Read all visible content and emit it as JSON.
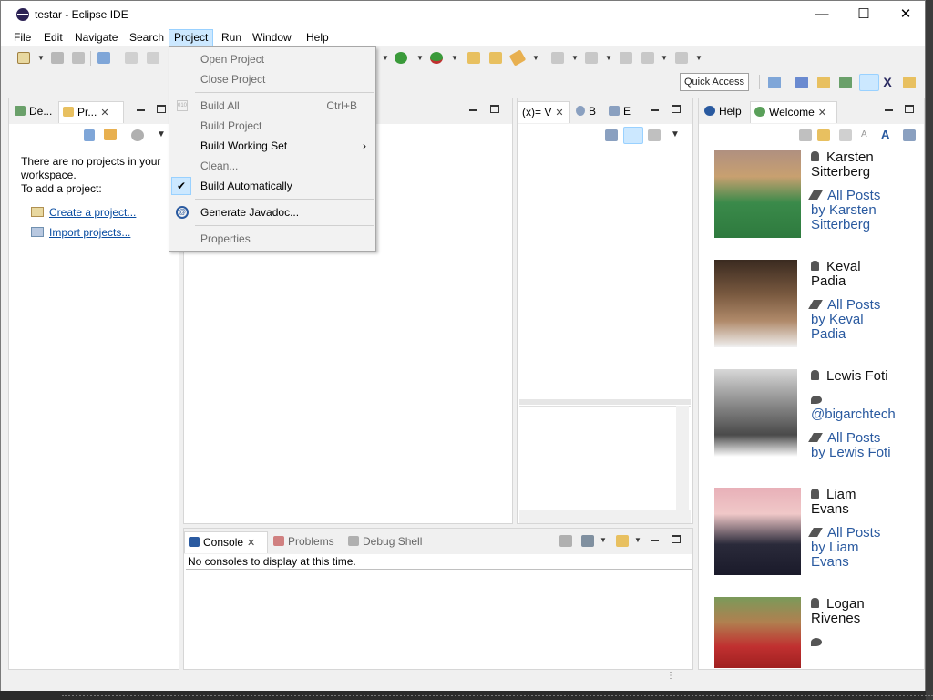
{
  "window": {
    "title": "testar - Eclipse IDE",
    "controls": {
      "minimize": "—",
      "maximize": "☐",
      "close": "✕"
    }
  },
  "menubar": [
    "File",
    "Edit",
    "Navigate",
    "Search",
    "Project",
    "Run",
    "Window",
    "Help"
  ],
  "active_menu": "Project",
  "project_menu": {
    "items": [
      {
        "label": "Open Project",
        "enabled": false
      },
      {
        "label": "Close Project",
        "enabled": false
      },
      {
        "label": "Build All",
        "accelerator": "Ctrl+B",
        "enabled": false
      },
      {
        "label": "Build Project",
        "enabled": false
      },
      {
        "label": "Build Working Set",
        "enabled": true,
        "submenu": true
      },
      {
        "label": "Clean...",
        "enabled": false
      },
      {
        "label": "Build Automatically",
        "enabled": true,
        "checked": true
      },
      {
        "label": "Generate Javadoc...",
        "enabled": true
      },
      {
        "label": "Properties",
        "enabled": false
      }
    ]
  },
  "quick_access": "Quick Access",
  "left_panel": {
    "tabs": [
      {
        "label": "De..."
      },
      {
        "label": "Pr...",
        "close": "✕"
      }
    ],
    "empty_message": [
      "There are no projects in your",
      "workspace.",
      "To add a project:"
    ],
    "links": [
      "Create a project...",
      "Import projects..."
    ]
  },
  "variables_panel": {
    "tabs": [
      {
        "label": "(x)= V",
        "close": "✕"
      },
      {
        "label": "B"
      },
      {
        "label": "E"
      }
    ]
  },
  "console_panel": {
    "tabs": [
      {
        "label": "Console",
        "close": "✕"
      },
      {
        "label": "Problems"
      },
      {
        "label": "Debug Shell"
      }
    ],
    "message": "No consoles to display at this time."
  },
  "welcome_panel": {
    "tabs": [
      {
        "label": "Help"
      },
      {
        "label": "Welcome",
        "close": "✕"
      }
    ],
    "authors": [
      {
        "name": [
          "Karsten",
          "Sitterberg"
        ],
        "posts": [
          "All Posts",
          "by Karsten",
          "Sitterberg"
        ]
      },
      {
        "name": [
          "Keval",
          "Padia"
        ],
        "posts": [
          "All Posts",
          "by Keval",
          "Padia"
        ]
      },
      {
        "name": [
          "Lewis Foti"
        ],
        "twitter": "@bigarchtech",
        "posts": [
          "All Posts",
          "by Lewis Foti"
        ]
      },
      {
        "name": [
          "Liam",
          "Evans"
        ],
        "posts": [
          "All Posts",
          "by Liam",
          "Evans"
        ]
      },
      {
        "name": [
          "Logan",
          "Rivenes"
        ]
      }
    ]
  },
  "colors": {
    "accent": "#cce8ff",
    "link": "#2a5aa0",
    "menu_bg": "#f2f2f2"
  }
}
